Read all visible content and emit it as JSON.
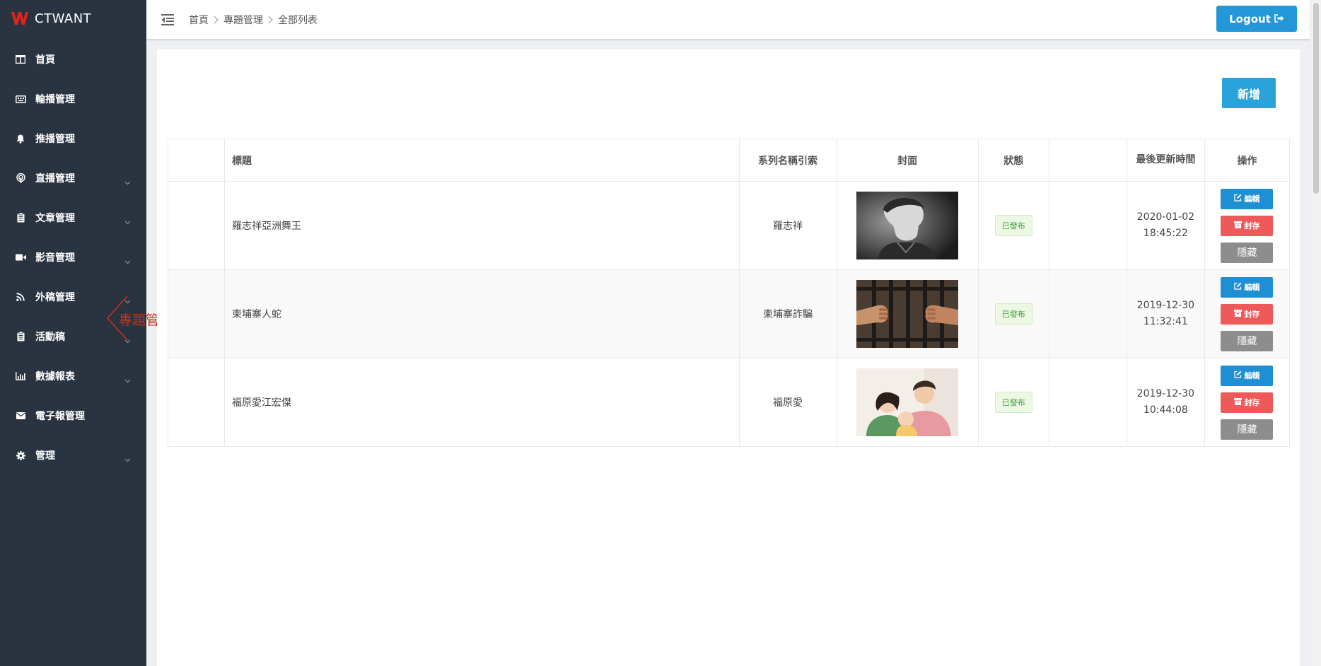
{
  "brand": {
    "name": "CTWANT",
    "logo_color": "#e2231a"
  },
  "sidebar": {
    "items": [
      {
        "label": "首頁",
        "icon": "columns-icon",
        "has_children": false
      },
      {
        "label": "輪播管理",
        "icon": "keyboard-icon",
        "has_children": false
      },
      {
        "label": "推播管理",
        "icon": "bell-icon",
        "has_children": false
      },
      {
        "label": "直播管理",
        "icon": "broadcast-icon",
        "has_children": true
      },
      {
        "label": "文章管理",
        "icon": "clipboard-icon",
        "has_children": true
      },
      {
        "label": "影音管理",
        "icon": "video-icon",
        "has_children": true
      },
      {
        "label": "外稿管理",
        "icon": "rss-icon",
        "has_children": true
      },
      {
        "label": "活動稿",
        "icon": "clipboard-icon",
        "has_children": true
      },
      {
        "label": "數據報表",
        "icon": "bar-chart-icon",
        "has_children": true
      },
      {
        "label": "電子報管理",
        "icon": "envelope-icon",
        "has_children": false
      },
      {
        "label": "管理",
        "icon": "gear-icon",
        "has_children": true
      }
    ],
    "flyout_label": "專題管理"
  },
  "header": {
    "breadcrumb": [
      "首頁",
      "專題管理",
      "全部列表"
    ],
    "logout_label": "Logout"
  },
  "main": {
    "add_label": "新增",
    "table": {
      "columns": [
        "",
        "標題",
        "系列名稱引索",
        "封面",
        "狀態",
        "",
        "最後更新時間",
        "操作"
      ],
      "rows": [
        {
          "title": "羅志祥亞洲舞王",
          "series": "羅志祥",
          "cover": "portrait-photo",
          "status": "已發布",
          "date": "2020-01-02",
          "time": "18:45:22"
        },
        {
          "title": "柬埔寨人蛇",
          "series": "柬埔寨詐騙",
          "cover": "prison-bars-photo",
          "status": "已發布",
          "date": "2019-12-30",
          "time": "11:32:41"
        },
        {
          "title": "福原愛江宏傑",
          "series": "福原愛",
          "cover": "family-photo",
          "status": "已發布",
          "date": "2019-12-30",
          "time": "10:44:08"
        }
      ],
      "actions": {
        "edit": "編輯",
        "archive": "封存",
        "hide": "隱藏"
      }
    }
  },
  "colors": {
    "sidebar_bg": "#2a3340",
    "primary": "#2397d8",
    "danger": "#ee5a5a",
    "muted": "#8d8d8d",
    "success": "#3c9b38"
  }
}
